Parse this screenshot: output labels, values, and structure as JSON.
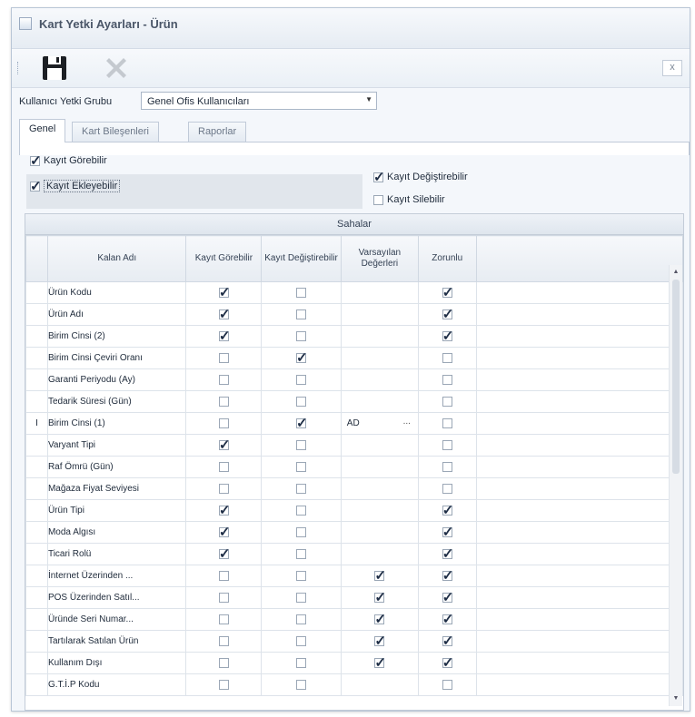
{
  "window": {
    "title": "Kart Yetki Ayarları - Ürün",
    "close_label": "x"
  },
  "toolbar": {
    "save_icon": "floppy-disk-icon",
    "delete_icon": "delete-x-icon"
  },
  "group": {
    "label": "Kullanıcı Yetki Grubu",
    "value": "Genel Ofis Kullanıcıları"
  },
  "tabs": [
    {
      "label": "Genel",
      "active": true
    },
    {
      "label": "Kart Bileşenleri",
      "active": false
    },
    {
      "label": "Raporlar",
      "active": false
    }
  ],
  "permissions": {
    "view": {
      "label": "Kayıt Görebilir",
      "checked": true
    },
    "add": {
      "label": "Kayıt Ekleyebilir",
      "checked": true
    },
    "edit": {
      "label": "Kayıt Değiştirebilir",
      "checked": true
    },
    "delete": {
      "label": "Kayıt Silebilir",
      "checked": false
    }
  },
  "grid": {
    "title": "Sahalar",
    "columns": {
      "field": "Kalan Adı",
      "view": "Kayıt Görebilir",
      "edit": "Kayıt Değiştirebilir",
      "default": "Varsayılan Değerleri",
      "required": "Zorunlu"
    },
    "rows": [
      {
        "name": "Ürün Kodu",
        "view": true,
        "edit": false,
        "default": "",
        "required": true
      },
      {
        "name": "Ürün Adı",
        "view": true,
        "edit": false,
        "default": "",
        "required": true
      },
      {
        "name": "Birim Cinsi (2)",
        "view": true,
        "edit": false,
        "default": "",
        "required": true
      },
      {
        "name": "Birim Cinsi Çeviri Oranı",
        "view": false,
        "edit": true,
        "default": "",
        "required": false
      },
      {
        "name": "Garanti Periyodu (Ay)",
        "view": false,
        "edit": false,
        "default": "",
        "required": false
      },
      {
        "name": "Tedarik Süresi (Gün)",
        "view": false,
        "edit": false,
        "default": "",
        "required": false
      },
      {
        "name": "Birim Cinsi (1)",
        "view": false,
        "edit": true,
        "default": "AD",
        "default_button": "...",
        "required": false,
        "indicator": "I"
      },
      {
        "name": "Varyant Tipi",
        "view": true,
        "edit": false,
        "default": "",
        "required": false
      },
      {
        "name": "Raf Ömrü (Gün)",
        "view": false,
        "edit": false,
        "default": "",
        "required": false
      },
      {
        "name": "Mağaza Fiyat Seviyesi",
        "view": false,
        "edit": false,
        "default": "",
        "required": false
      },
      {
        "name": "Ürün Tipi",
        "view": true,
        "edit": false,
        "default": "",
        "required": true
      },
      {
        "name": "Moda Algısı",
        "view": true,
        "edit": false,
        "default": "",
        "required": true
      },
      {
        "name": "Ticari Rolü",
        "view": true,
        "edit": false,
        "default": "",
        "required": true
      },
      {
        "name": "İnternet Üzerinden ...",
        "view": false,
        "edit": false,
        "default_check": true,
        "required": true
      },
      {
        "name": "POS Üzerinden Satıl...",
        "view": false,
        "edit": false,
        "default_check": true,
        "required": true
      },
      {
        "name": "Üründe Seri Numar...",
        "view": false,
        "edit": false,
        "default_check": true,
        "required": true
      },
      {
        "name": "Tartılarak Satılan Ürün",
        "view": false,
        "edit": false,
        "default_check": true,
        "required": true
      },
      {
        "name": "Kullanım Dışı",
        "view": false,
        "edit": false,
        "default_check": true,
        "required": true
      },
      {
        "name": "G.T.İ.P Kodu",
        "view": false,
        "edit": false,
        "default": "",
        "required": false
      }
    ]
  }
}
